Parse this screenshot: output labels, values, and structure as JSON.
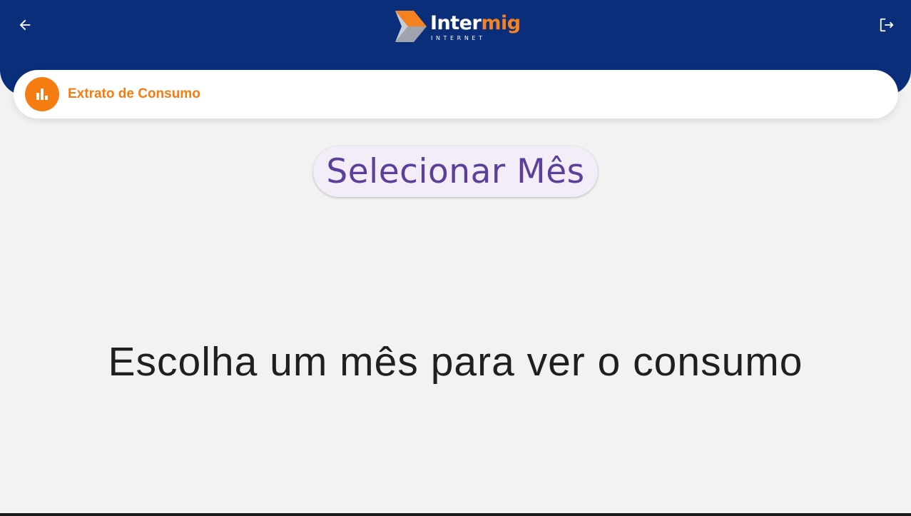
{
  "header": {
    "back_icon": "arrow-left-icon",
    "logout_icon": "logout-icon",
    "logo": {
      "word_part1": "Inter",
      "word_part2": "mig",
      "subtitle": "INTERNET"
    }
  },
  "page": {
    "title": "Extrato de Consumo",
    "title_icon": "bar-chart-icon"
  },
  "main": {
    "select_month_label": "Selecionar Mês",
    "empty_message": "Escolha um mês para ver o consumo"
  },
  "colors": {
    "header_bg": "#0a2e7a",
    "accent_orange": "#f57c10",
    "button_bg": "#f3edf7",
    "button_text": "#5b3f9a",
    "page_bg": "#f2f2f2"
  }
}
